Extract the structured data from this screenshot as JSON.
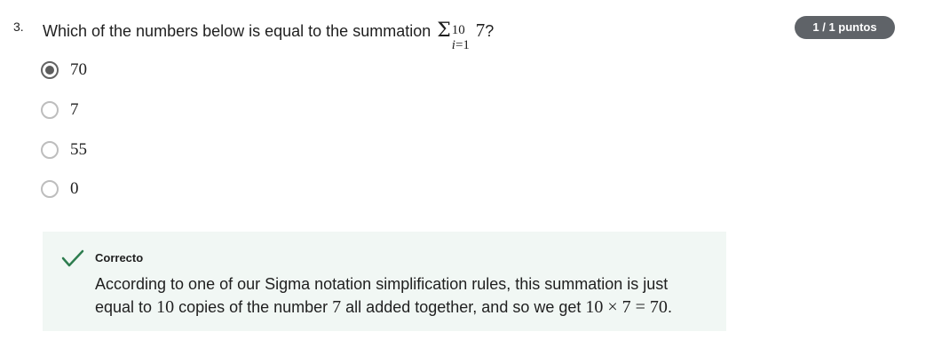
{
  "question": {
    "number": "3.",
    "text_before": "Which of the numbers below is equal to the summation ",
    "sigma_symbol": "Σ",
    "upper_limit": "10",
    "lower_index": "i",
    "lower_equals": "=1",
    "summand": "7",
    "text_after": "?"
  },
  "score": {
    "label": "1 / 1 puntos"
  },
  "options": [
    {
      "label": "70",
      "selected": true
    },
    {
      "label": "7",
      "selected": false
    },
    {
      "label": "55",
      "selected": false
    },
    {
      "label": "0",
      "selected": false
    }
  ],
  "feedback": {
    "status": "Correcto",
    "icon": "checkmark-icon",
    "color": "#2e7d4f",
    "line1": "According to one of our Sigma notation simplification rules, this summation is just",
    "line2_a": "equal to ",
    "line2_m1": "10",
    "line2_b": " copies of the number ",
    "line2_m2": "7",
    "line2_c": " all added together, and so we get ",
    "line2_m3": "10 × 7 = 70",
    "line2_d": "."
  },
  "colors": {
    "badge_background": "#5f6368",
    "feedback_background": "#f1f7f4",
    "check_color": "#2e7d4f"
  }
}
